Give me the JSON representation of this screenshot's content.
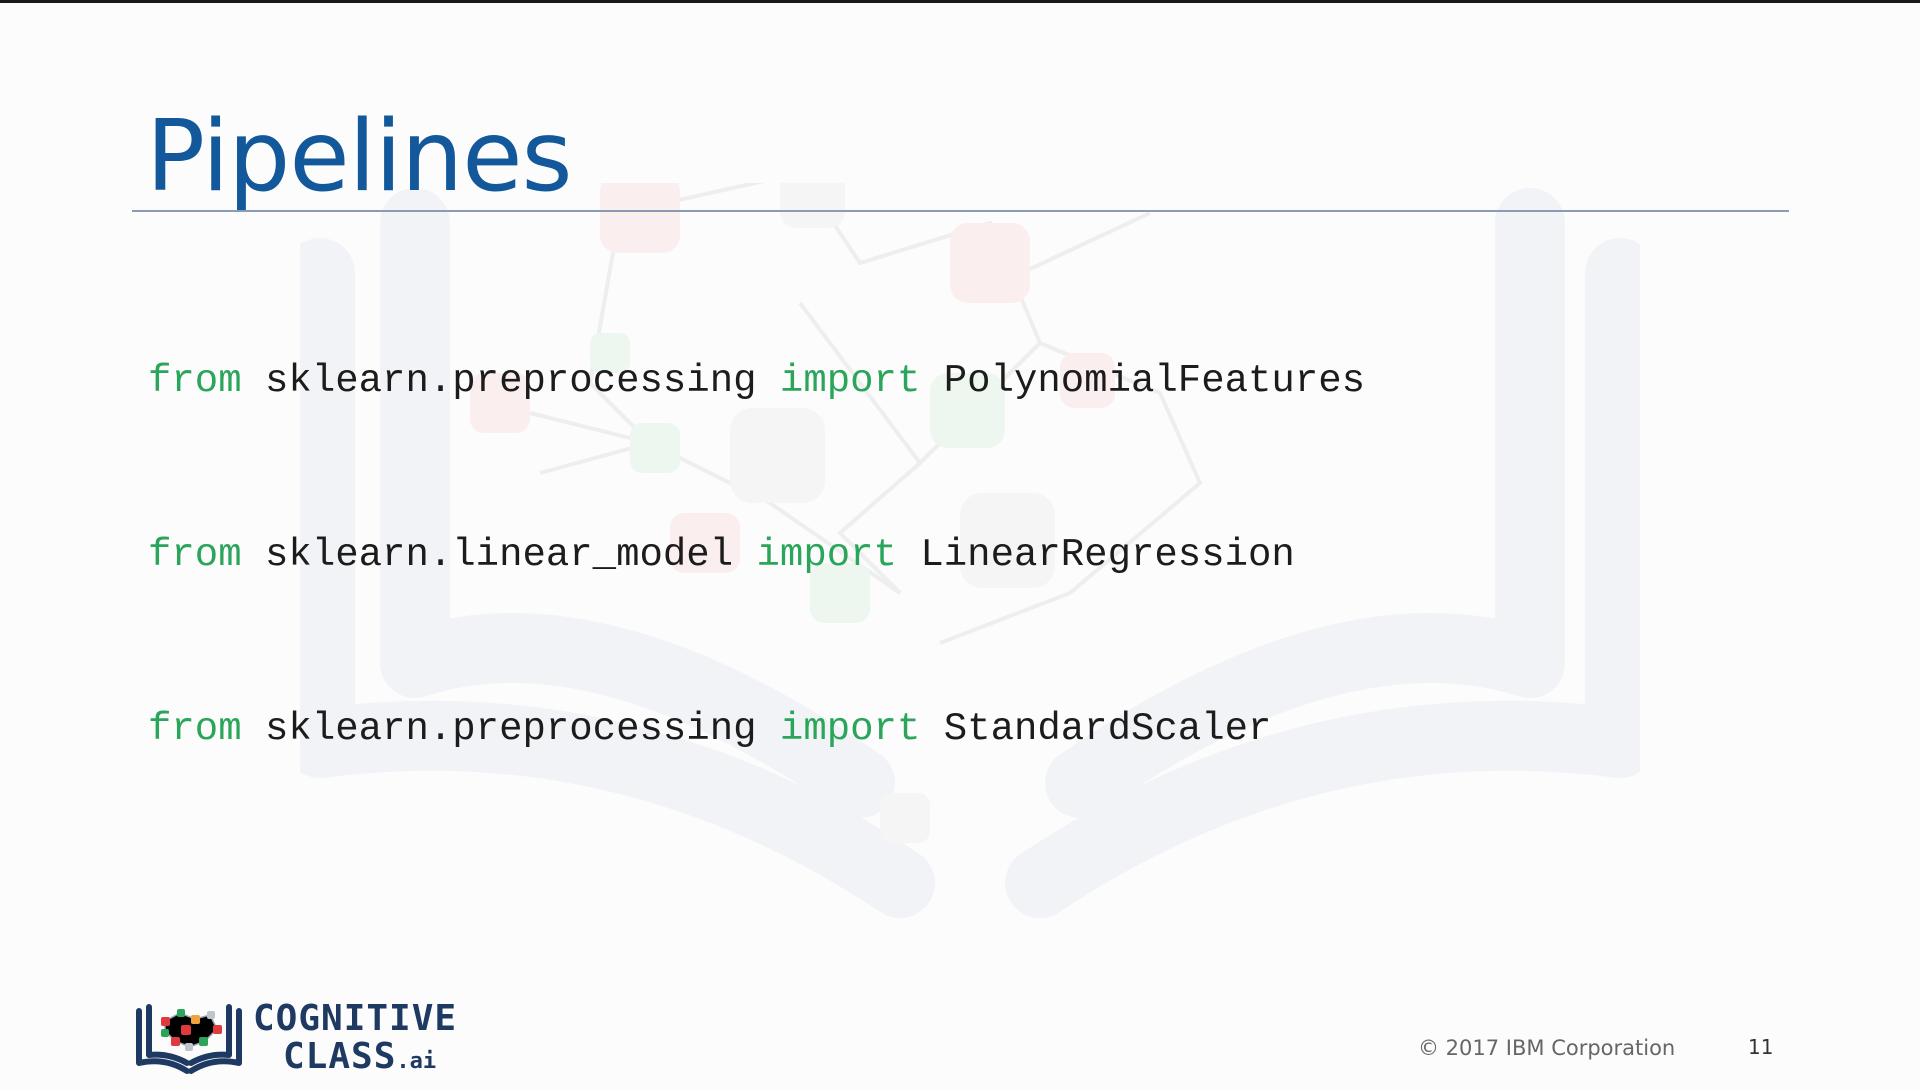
{
  "slide": {
    "title": "Pipelines",
    "code_lines": [
      {
        "kw_from": "from",
        "module": " sklearn.preprocessing ",
        "kw_import": "import",
        "name": " PolynomialFeatures"
      },
      {
        "kw_from": "from",
        "module": " sklearn.linear_model ",
        "kw_import": "import",
        "name": " LinearRegression"
      },
      {
        "kw_from": "from",
        "module": " sklearn.preprocessing ",
        "kw_import": "import",
        "name": " StandardScaler"
      }
    ],
    "footer": {
      "logo_line1": "COGNITIVE",
      "logo_line2": "CLASS",
      "logo_suffix": ".ai",
      "copyright": "© 2017 IBM Corporation",
      "page_number": "11"
    }
  },
  "colors": {
    "title": "#12589b",
    "keyword": "#2aa55a",
    "code_text": "#1c1c1c",
    "rule": "#8a9bb5"
  },
  "icons": {
    "watermark": "open-book-network-icon",
    "logo": "book-brain-logo-icon"
  }
}
